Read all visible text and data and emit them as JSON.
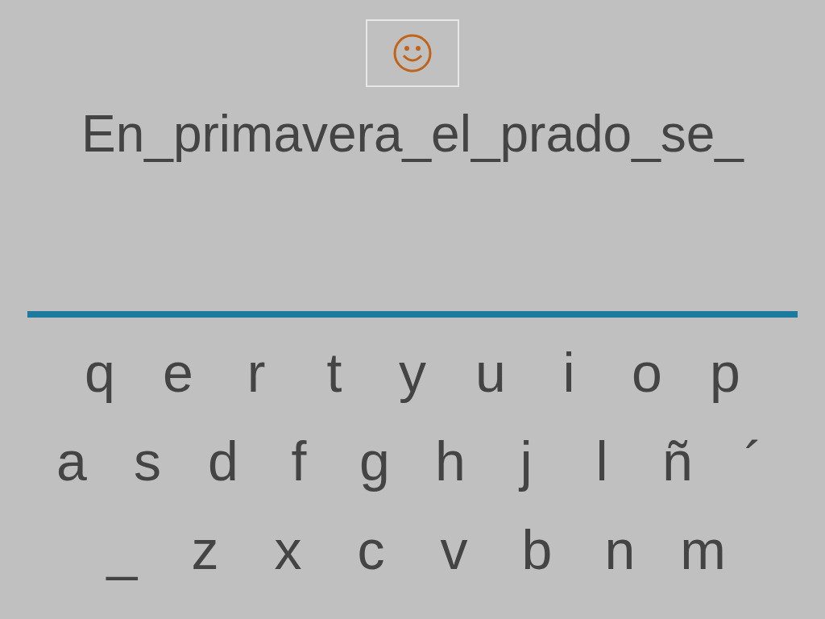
{
  "sentence": "En_primavera_el_prado_se_",
  "keyboard": [
    [
      "q",
      "e",
      "r",
      "t",
      "y",
      "u",
      "i",
      "o",
      "p"
    ],
    [
      "a",
      "s",
      "d",
      "f",
      "g",
      "h",
      "j",
      "l",
      "ñ",
      "´"
    ],
    [
      "_",
      "z",
      "x",
      "c",
      "v",
      "b",
      "n",
      "m"
    ]
  ]
}
